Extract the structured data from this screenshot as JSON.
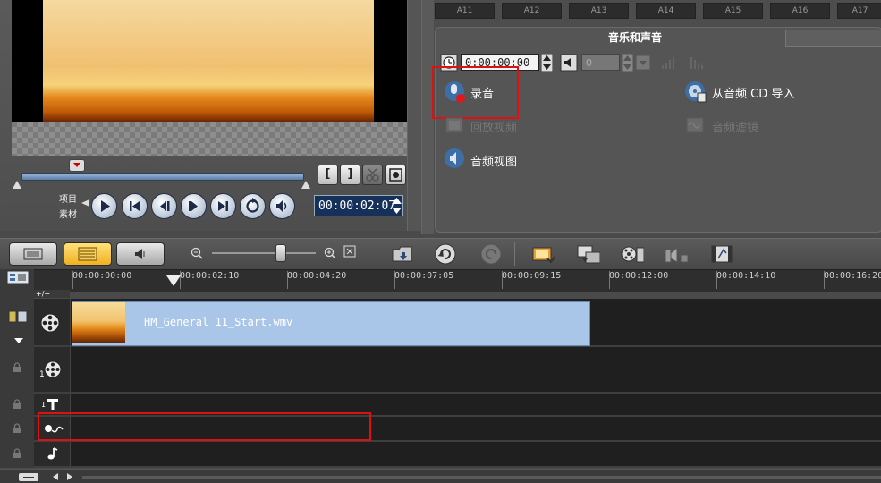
{
  "preview": {
    "mode_project": "项目",
    "mode_clip": "素材",
    "mark_in": "[",
    "mark_out": "]",
    "timecode": "00:00:02:07"
  },
  "track_tabs": [
    "A11",
    "A12",
    "A13",
    "A14",
    "A15",
    "A16",
    "A17"
  ],
  "options_panel": {
    "title": "音乐和声音",
    "duration": "0:00:00:00",
    "volume": "0",
    "record_label": "录音",
    "import_cd_label": "从音频 CD 导入",
    "playback_label": "回放视频",
    "audio_filter_label": "音频滤镜",
    "audio_view_label": "音频视图"
  },
  "timeline": {
    "ruler_labels": [
      "00:00:00:00",
      "00:00:02:10",
      "00:00:04:20",
      "00:00:07:05",
      "00:00:09:15",
      "00:00:12:00",
      "00:00:14:10",
      "00:00:16:20"
    ],
    "clip_name": "HM_General 11_Start.wmv",
    "overlay_index": "1",
    "title_index": "1",
    "add_label": "+/−"
  },
  "colors": {
    "highlight_red": "#e01010",
    "active_view": "#f0b020",
    "clip_fill": "#a9c6e8"
  }
}
